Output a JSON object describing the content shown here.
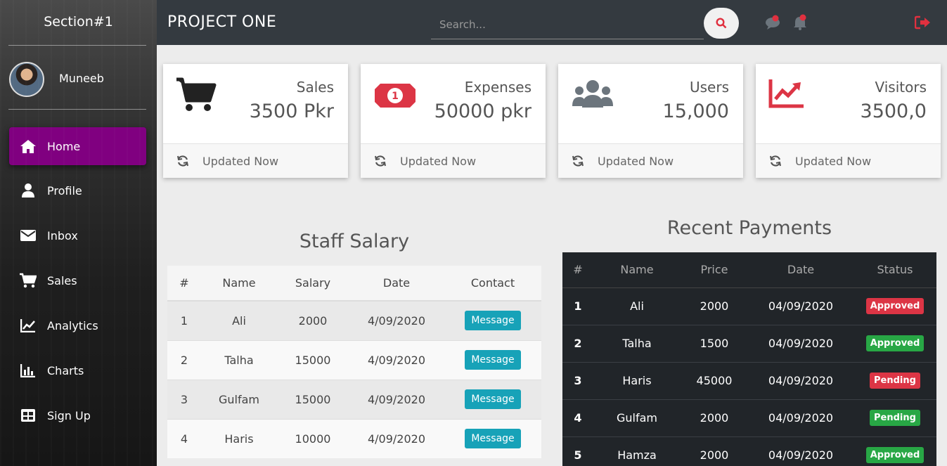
{
  "sidebar": {
    "brand": "Section#1",
    "user": "Muneeb",
    "items": [
      {
        "label": "Home",
        "icon": "home-icon"
      },
      {
        "label": "Profile",
        "icon": "user-icon"
      },
      {
        "label": "Inbox",
        "icon": "envelope-icon"
      },
      {
        "label": "Sales",
        "icon": "cart-icon"
      },
      {
        "label": "Analytics",
        "icon": "line-chart-icon"
      },
      {
        "label": "Charts",
        "icon": "bar-chart-icon"
      },
      {
        "label": "Sign Up",
        "icon": "table-icon"
      }
    ],
    "active_color": "#800080"
  },
  "header": {
    "title": "PROJECT ONE",
    "search_placeholder": "Search..."
  },
  "cards": [
    {
      "label": "Sales",
      "value": "3500 Pkr",
      "footer": "Updated Now",
      "icon": "cart-icon"
    },
    {
      "label": "Expenses",
      "value": "50000 pkr",
      "footer": "Updated Now",
      "icon": "money-bill-icon"
    },
    {
      "label": "Users",
      "value": "15,000",
      "footer": "Updated Now",
      "icon": "users-icon"
    },
    {
      "label": "Visitors",
      "value": "3500,0",
      "footer": "Updated Now",
      "icon": "trend-chart-icon"
    }
  ],
  "staff": {
    "title": "Staff Salary",
    "headers": [
      "#",
      "Name",
      "Salary",
      "Date",
      "Contact"
    ],
    "button_label": "Message",
    "rows": [
      {
        "n": "1",
        "name": "Ali",
        "salary": "2000",
        "date": "4/09/2020"
      },
      {
        "n": "2",
        "name": "Talha",
        "salary": "15000",
        "date": "4/09/2020"
      },
      {
        "n": "3",
        "name": "Gulfam",
        "salary": "15000",
        "date": "4/09/2020"
      },
      {
        "n": "4",
        "name": "Haris",
        "salary": "10000",
        "date": "4/09/2020"
      }
    ]
  },
  "payments": {
    "title": "Recent Payments",
    "headers": [
      "#",
      "Name",
      "Price",
      "Date",
      "Status"
    ],
    "rows": [
      {
        "n": "1",
        "name": "Ali",
        "price": "2000",
        "date": "04/09/2020",
        "status": "Approved",
        "color": "#dc3545"
      },
      {
        "n": "2",
        "name": "Talha",
        "price": "1500",
        "date": "04/09/2020",
        "status": "Approved",
        "color": "#28a745"
      },
      {
        "n": "3",
        "name": "Haris",
        "price": "45000",
        "date": "04/09/2020",
        "status": "Pending",
        "color": "#dc3545"
      },
      {
        "n": "4",
        "name": "Gulfam",
        "price": "2000",
        "date": "04/09/2020",
        "status": "Pending",
        "color": "#28a745"
      },
      {
        "n": "5",
        "name": "Hamza",
        "price": "2000",
        "date": "04/09/2020",
        "status": "Approved",
        "color": "#28a745"
      }
    ]
  }
}
